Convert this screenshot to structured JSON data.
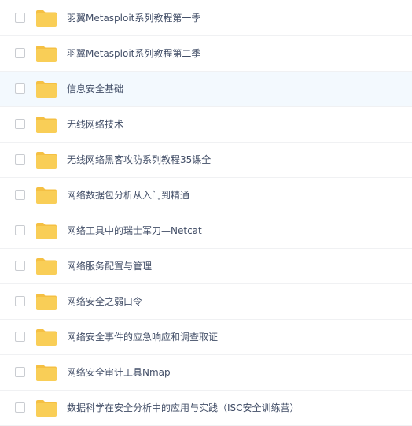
{
  "files": [
    {
      "name": "羽翼Metasploit系列教程第一季",
      "type": "folder",
      "icon": "folder-icon",
      "checked": false
    },
    {
      "name": "羽翼Metasploit系列教程第二季",
      "type": "folder",
      "icon": "folder-icon",
      "checked": false
    },
    {
      "name": "信息安全基础",
      "type": "folder",
      "icon": "folder-icon",
      "checked": false,
      "hovered": true
    },
    {
      "name": "无线网络技术",
      "type": "folder",
      "icon": "folder-icon",
      "checked": false
    },
    {
      "name": "无线网络黑客攻防系列教程35课全",
      "type": "folder",
      "icon": "folder-icon",
      "checked": false
    },
    {
      "name": "网络数据包分析从入门到精通",
      "type": "folder",
      "icon": "folder-icon",
      "checked": false
    },
    {
      "name": "网络工具中的瑞士军刀—Netcat",
      "type": "folder",
      "icon": "folder-icon",
      "checked": false
    },
    {
      "name": "网络服务配置与管理",
      "type": "folder",
      "icon": "folder-icon",
      "checked": false
    },
    {
      "name": "网络安全之弱口令",
      "type": "folder",
      "icon": "folder-icon",
      "checked": false
    },
    {
      "name": "网络安全事件的应急响应和调查取证",
      "type": "folder",
      "icon": "folder-icon",
      "checked": false
    },
    {
      "name": "网络安全审计工具Nmap",
      "type": "folder",
      "icon": "folder-icon",
      "checked": false
    },
    {
      "name": "数据科学在安全分析中的应用与实践（ISC安全训练营）",
      "type": "folder",
      "icon": "folder-icon",
      "checked": false
    }
  ],
  "colors": {
    "folder_body": "#f9ce57",
    "folder_tab": "#f5c043",
    "row_hover": "#f3f9fe",
    "text": "#424e67",
    "checkbox_border": "#c9ccd1",
    "divider": "#f0f1f3"
  }
}
